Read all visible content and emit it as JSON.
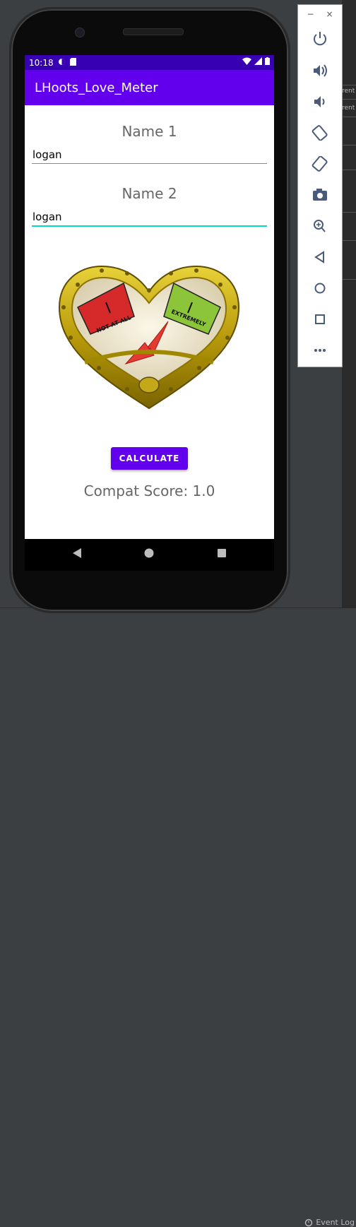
{
  "status": {
    "time": "10:18"
  },
  "app": {
    "title": "LHoots_Love_Meter"
  },
  "form": {
    "name1_label": "Name 1",
    "name1_value": "logan",
    "name2_label": "Name 2",
    "name2_value": "logan"
  },
  "meter": {
    "left_label": "NOT AT ALL",
    "right_label": "EXTREMELY"
  },
  "actions": {
    "calculate_label": "CALCULATE"
  },
  "result": {
    "score_text": "Compat Score: 1.0"
  },
  "ide": {
    "event_log": "Event Log",
    "strip_texts": [
      "rent",
      "rent"
    ]
  },
  "emulator_panel": {
    "minimize": "−",
    "close": "×",
    "tools": [
      "power-icon",
      "volume-up-icon",
      "volume-down-icon",
      "rotate-left-icon",
      "rotate-right-icon",
      "camera-icon",
      "zoom-icon",
      "back-icon",
      "home-icon",
      "overview-icon",
      "more-icon"
    ]
  }
}
